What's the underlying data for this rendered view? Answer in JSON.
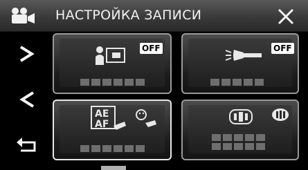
{
  "header": {
    "title": "НАСТРОЙКА ЗАПИСИ",
    "mode_icon": "video-camera-icon",
    "close_icon": "close-x-icon"
  },
  "nav": {
    "next_icon": "chevron-right-icon",
    "prev_icon": "chevron-left-icon",
    "back_icon": "return-arrow-icon"
  },
  "tiles": [
    {
      "name": "backlight-compensation",
      "badge": "OFF",
      "value_placeholder": "▪▪▪▪▪▪"
    },
    {
      "name": "video-light",
      "badge": "OFF",
      "value_placeholder": "▪▪▪▪▪"
    },
    {
      "name": "touch-priority-ae-af",
      "value_placeholder": "▪▪▪▪▪▪"
    },
    {
      "name": "wind-cut",
      "value_placeholder": "▪▪▪▪▪▪"
    }
  ],
  "colors": {
    "background": "#000000",
    "badge": "#ffffff",
    "border": "#9a9a9a"
  }
}
